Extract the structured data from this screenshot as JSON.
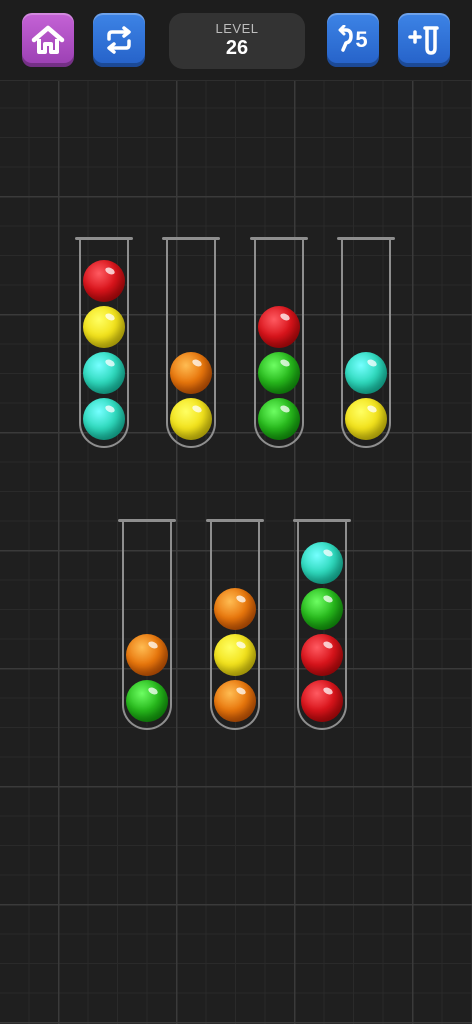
{
  "hud": {
    "level_label": "LEVEL",
    "level_number": "26",
    "undo_count": "5",
    "buttons": [
      "home",
      "restart",
      "undo",
      "add-tube"
    ]
  },
  "colors": {
    "red": "#d9141b",
    "yellow": "#f2e21c",
    "teal": "#2fd9bd",
    "orange": "#e8760c",
    "green": "#27b81c",
    "home_button": "#b04cc4",
    "blue_button": "#2f70d6"
  },
  "tubes": [
    {
      "balls": [
        "teal",
        "teal",
        "yellow",
        "red"
      ]
    },
    {
      "balls": [
        "yellow",
        "orange"
      ]
    },
    {
      "balls": [
        "green",
        "green",
        "red"
      ]
    },
    {
      "balls": [
        "yellow",
        "teal"
      ]
    },
    {
      "balls": [
        "green",
        "orange"
      ]
    },
    {
      "balls": [
        "orange",
        "yellow",
        "orange"
      ]
    },
    {
      "balls": [
        "red",
        "red",
        "green",
        "teal"
      ]
    }
  ]
}
